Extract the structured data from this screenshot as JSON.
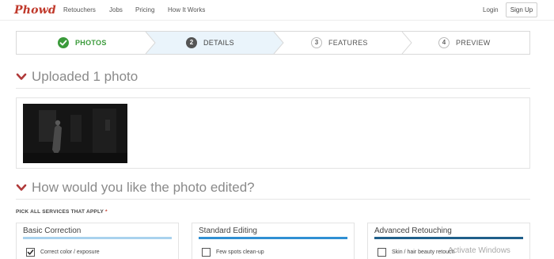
{
  "nav": {
    "brand": "Phowd",
    "links": [
      "Retouchers",
      "Jobs",
      "Pricing",
      "How It Works"
    ],
    "login": "Login",
    "signup": "Sign Up"
  },
  "stepper": {
    "steps": [
      {
        "number": "",
        "label": "PHOTOS",
        "state": "completed",
        "icon": "check-icon"
      },
      {
        "number": "2",
        "label": "DETAILS",
        "state": "active"
      },
      {
        "number": "3",
        "label": "FEATURES",
        "state": "upcoming"
      },
      {
        "number": "4",
        "label": "PREVIEW",
        "state": "upcoming"
      }
    ]
  },
  "uploads": {
    "title": "Uploaded 1 photo",
    "photo_count": 1
  },
  "services": {
    "title": "How would you like the photo edited?",
    "pick_label": "PICK ALL SERVICES THAT APPLY",
    "required_mark": "*",
    "cards": [
      {
        "title": "Basic Correction",
        "bar_color": "#a9d2ee",
        "option": "Correct color / exposure",
        "checked": true
      },
      {
        "title": "Standard Editing",
        "bar_color": "#2f8fd3",
        "option": "Few spots clean-up",
        "checked": false
      },
      {
        "title": "Advanced Retouching",
        "bar_color": "#1f5f8a",
        "option": "Skin / hair beauty retouch",
        "checked": false
      }
    ]
  },
  "watermark": "Activate Windows",
  "colors": {
    "brand": "#c0392b",
    "completed_green": "#3a9a3a",
    "active_step_bg": "#eaf4fb",
    "chevron_red": "#b03a3a"
  }
}
